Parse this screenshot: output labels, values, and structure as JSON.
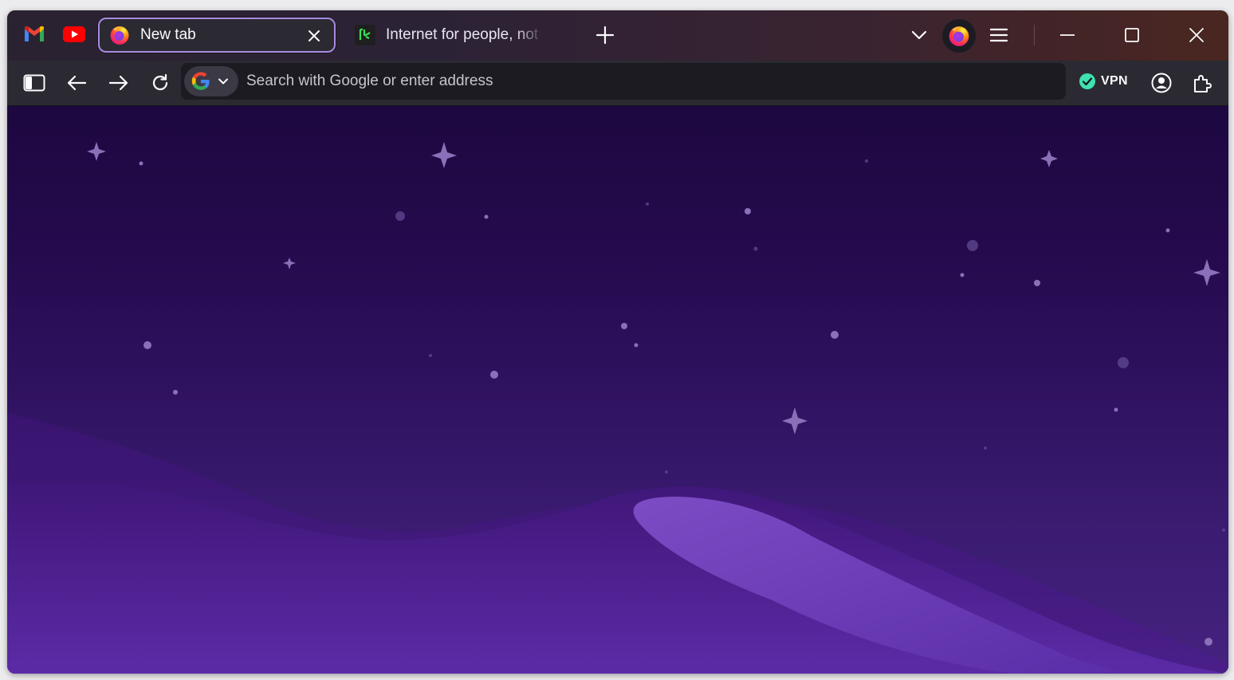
{
  "window": {
    "title": "New tab"
  },
  "pinned_tabs": [
    {
      "name": "gmail",
      "icon": "gmail-icon"
    },
    {
      "name": "youtube",
      "icon": "youtube-icon"
    }
  ],
  "tabs": [
    {
      "title": "New tab",
      "active": true,
      "icon": "firefox-icon"
    },
    {
      "title": "Internet for people, not profit",
      "active": false,
      "icon": "mozilla-icon"
    }
  ],
  "tabstrip_controls": {
    "new_tab": "plus-icon",
    "list_all_tabs": "chevron-down-icon",
    "account": "firefox-account-icon",
    "menu": "hamburger-menu-icon",
    "minimize": "minimize-icon",
    "maximize": "maximize-icon",
    "close": "close-icon"
  },
  "navbar": {
    "sidebar_toggle": "sidebar-icon",
    "back": "back-arrow-icon",
    "forward": "forward-arrow-icon",
    "reload": "reload-icon",
    "search_engine": "google-icon",
    "url_placeholder": "Search with Google or enter address",
    "url_value": "",
    "vpn_label": "VPN",
    "vpn_status": "connected",
    "account_icon": "account-icon",
    "extensions_icon": "extensions-icon"
  },
  "theme": {
    "accent": "#a78bdf",
    "vpn_green": "#3fe1b0",
    "background_top": "#1d0840",
    "background_bottom": "#45227f"
  }
}
